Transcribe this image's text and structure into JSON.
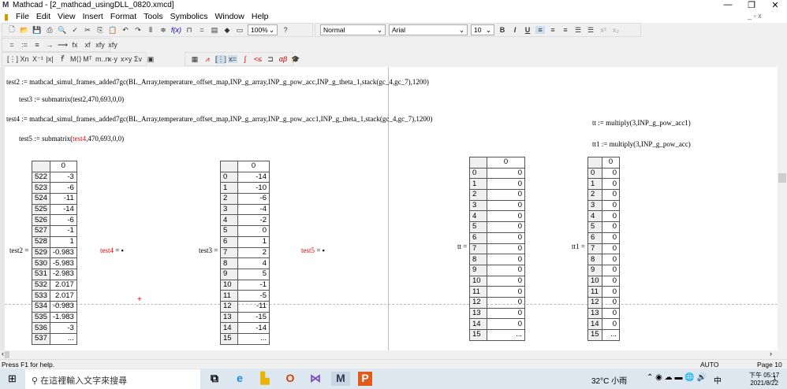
{
  "window": {
    "title": "Mathcad - [2_mathcad_usingDLL_0820.xmcd]"
  },
  "menu": [
    "File",
    "Edit",
    "View",
    "Insert",
    "Format",
    "Tools",
    "Symbolics",
    "Window",
    "Help"
  ],
  "toolbar": {
    "zoom": "100%",
    "style": "Normal",
    "font": "Arial",
    "size": "10",
    "bold": "B",
    "italic": "I",
    "underline": "U"
  },
  "math_toolbar": [
    "=",
    ":=",
    "≡",
    "→",
    "⟶",
    "fx",
    "xf",
    "xfy",
    "xfy"
  ],
  "doc": {
    "expr1": "test2 := mathcad_simul_frames_added7gc(BL_Array,temperature_offset_map,INP_g_array,INP_g_pow_acc,INP_g_theta_1,stack(gc_4,gc_7),1200)",
    "expr2": "test3 := submatrix(test2,470,693,0,0)",
    "expr3": "test4 := mathcad_simul_frames_added7gc(BL_Array,temperature_offset_map,INP_g_array,INP_g_pow_acc1,INP_g_theta_1,stack(gc_4,gc_7),1200)",
    "expr4a": "test5 := submatrix(",
    "expr4b": "test4",
    "expr4c": ",470,693,0,0)",
    "expr5": "tt := multiply(3,INP_g_pow_acc1)",
    "expr6": "tt1 := multiply(3,INP_g_pow_acc)",
    "eval_test4": "test4",
    "eval_test5": "test5",
    "eq": " ="
  },
  "matrices": [
    {
      "name": "test2",
      "col": "0",
      "rows": [
        "522",
        "523",
        "524",
        "525",
        "526",
        "527",
        "528",
        "529",
        "530",
        "531",
        "532",
        "533",
        "534",
        "535",
        "536",
        "537"
      ],
      "values": [
        "-3",
        "-6",
        "-11",
        "-14",
        "-6",
        "-1",
        "1",
        "-0.983",
        "-5.983",
        "-2.983",
        "2.017",
        "2.017",
        "-0.983",
        "-1.983",
        "-3",
        "..."
      ]
    },
    {
      "name": "test3",
      "col": "0",
      "rows": [
        "0",
        "1",
        "2",
        "3",
        "4",
        "5",
        "6",
        "7",
        "8",
        "9",
        "10",
        "11",
        "12",
        "13",
        "14",
        "15"
      ],
      "values": [
        "-14",
        "-10",
        "-6",
        "-4",
        "-2",
        "0",
        "1",
        "2",
        "4",
        "5",
        "-1",
        "-5",
        "-11",
        "-15",
        "-14",
        "..."
      ]
    },
    {
      "name": "tt",
      "col": "0",
      "rows": [
        "0",
        "1",
        "2",
        "3",
        "4",
        "5",
        "6",
        "7",
        "8",
        "9",
        "10",
        "11",
        "12",
        "13",
        "14",
        "15"
      ],
      "values": [
        "0",
        "0",
        "0",
        "0",
        "0",
        "0",
        "0",
        "0",
        "0",
        "0",
        "0",
        "0",
        "0",
        "0",
        "0",
        "..."
      ]
    },
    {
      "name": "tt1",
      "col": "0",
      "rows": [
        "0",
        "1",
        "2",
        "3",
        "4",
        "5",
        "6",
        "7",
        "8",
        "9",
        "10",
        "11",
        "12",
        "13",
        "14",
        "15"
      ],
      "values": [
        "0",
        "0",
        "0",
        "0",
        "0",
        "0",
        "0",
        "0",
        "0",
        "0",
        "0",
        "0",
        "0",
        "0",
        "0",
        "..."
      ]
    }
  ],
  "status": {
    "help": "Press F1 for help.",
    "mode": "AUTO",
    "page": "Page 10"
  },
  "taskbar": {
    "search": "在這裡輸入文字來搜尋",
    "weather": "32°C 小雨",
    "time": "下午 05:17",
    "date": "2021/8/22",
    "ime": "中",
    "notif": "1"
  }
}
